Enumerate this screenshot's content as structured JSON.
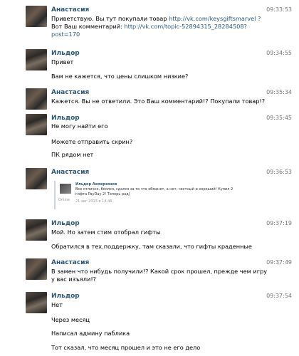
{
  "messages": [
    {
      "author": "Анастасия",
      "time": "09:33:53",
      "lines": [
        {
          "text": "Приветствую. Вы тут покупали товар ",
          "link": "http://vk.com/keysgiftsmarvel ?"
        },
        {
          "text": "Вот Ваш комментарий: ",
          "link": "http://vk.com/topic-52894315_28284508?"
        },
        {
          "text": "",
          "link": "post=170"
        }
      ]
    },
    {
      "author": "Ильдор",
      "time": "09:34:55",
      "lines": [
        {
          "text": "Привет"
        },
        {
          "text": "Вам не кажется, что цены слишком низкие?"
        }
      ]
    },
    {
      "author": "Анастасия",
      "time": "09:35:34",
      "lines": [
        {
          "text": "Кажется. Вы не ответили. Это Ваш комментарий!? Покупали товар!?"
        }
      ]
    },
    {
      "author": "Ильдор",
      "time": "09:35:45",
      "lines": [
        {
          "text": "Не могу найти его"
        },
        {
          "text": "Можете отправить скрин?"
        },
        {
          "text": "ПК рядом нет"
        }
      ]
    },
    {
      "author": "Анастасия",
      "time": "09:36:53",
      "forwarded": {
        "author": "Ильдор Ахмерзянов",
        "status": "Online",
        "text": "Все отлично, боялся, сдался за то что обманет, а нет, честный и хороший! Купил 2 гифта PayDay 2! Теперь рад)",
        "date": "21 авг 2013 в 14:46"
      }
    },
    {
      "author": "Ильдор",
      "time": "09:37:19",
      "lines": [
        {
          "text": "Мой. Но затем стим отобрал гифты"
        },
        {
          "text": "Обратился в тех.поддержку, там сказали, что гифты краденные"
        }
      ]
    },
    {
      "author": "Анастасия",
      "time": "09:37:49",
      "lines": [
        {
          "text": "В замен что нибудь получили!? Какой срок прошел, прежде чем игру"
        },
        {
          "text": "у вас изъяли!?"
        }
      ]
    },
    {
      "author": "Ильдор",
      "time": "09:37:54",
      "lines": [
        {
          "text": "Нет"
        },
        {
          "text": "Через месяц"
        },
        {
          "text": "Написал админу паблика"
        },
        {
          "text": "Тот сказал, что месяц прошел и это не его дело"
        }
      ]
    }
  ]
}
